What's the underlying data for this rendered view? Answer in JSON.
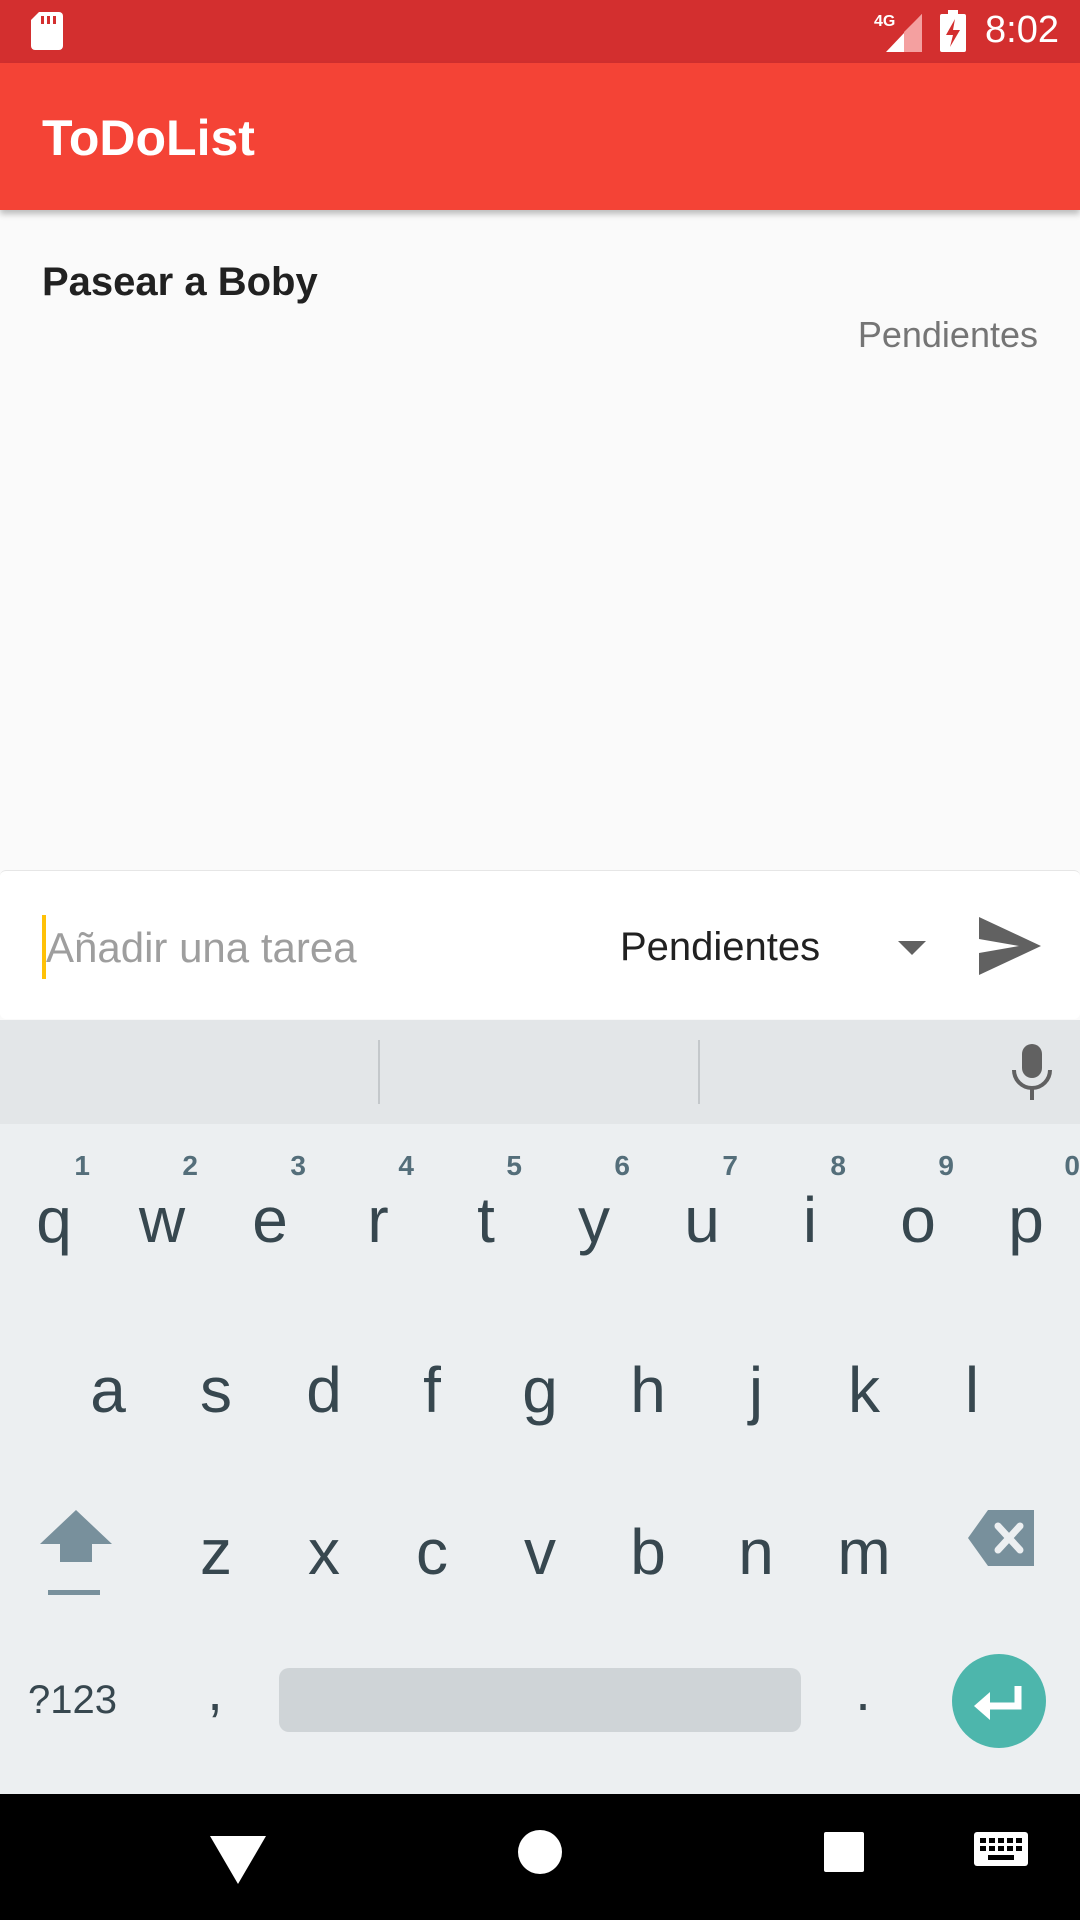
{
  "status_bar": {
    "time": "8:02",
    "network": "4G",
    "icons": [
      "sd-card-icon",
      "signal-4g-icon",
      "battery-charging-icon"
    ]
  },
  "app_bar": {
    "title": "ToDoList"
  },
  "tasks": [
    {
      "title": "Pasear a Boby",
      "status": "Pendientes"
    }
  ],
  "composer": {
    "placeholder": "Añadir una tarea",
    "value": "",
    "status_selected": "Pendientes",
    "send_icon": "send-icon"
  },
  "keyboard": {
    "row1": [
      {
        "key": "q",
        "hint": "1"
      },
      {
        "key": "w",
        "hint": "2"
      },
      {
        "key": "e",
        "hint": "3"
      },
      {
        "key": "r",
        "hint": "4"
      },
      {
        "key": "t",
        "hint": "5"
      },
      {
        "key": "y",
        "hint": "6"
      },
      {
        "key": "u",
        "hint": "7"
      },
      {
        "key": "i",
        "hint": "8"
      },
      {
        "key": "o",
        "hint": "9"
      },
      {
        "key": "p",
        "hint": "0"
      }
    ],
    "row2": [
      "a",
      "s",
      "d",
      "f",
      "g",
      "h",
      "j",
      "k",
      "l"
    ],
    "row3": [
      "z",
      "x",
      "c",
      "v",
      "b",
      "n",
      "m"
    ],
    "symbols_label": "?123",
    "comma": ",",
    "period": "."
  },
  "colors": {
    "status_bar": "#d32f2f",
    "app_bar": "#f44336",
    "enter_key": "#4db6ac",
    "cursor": "#ffc107"
  }
}
